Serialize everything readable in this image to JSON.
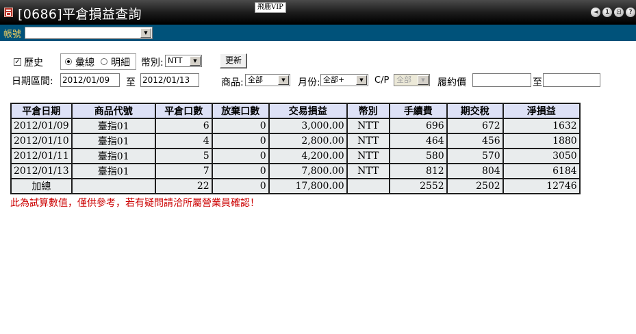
{
  "window": {
    "title": "[0686]平倉損益查詢",
    "vip_badge": "飛鹿VIP",
    "buttons": [
      "◄",
      "1",
      "⊡",
      "?"
    ]
  },
  "account": {
    "label": "帳號",
    "value": ""
  },
  "form": {
    "history_checkbox": {
      "label": "歷史",
      "checked": true
    },
    "summary_radio": {
      "label": "彙總",
      "selected": true
    },
    "detail_radio": {
      "label": "明細",
      "selected": false
    },
    "currency_label": "幣別:",
    "currency_value": "NTT",
    "refresh_button": "更新",
    "date_range_label": "日期區間:",
    "date_from": "2012/01/09",
    "date_to_label": "至",
    "date_to": "2012/01/13",
    "product_label": "商品:",
    "product_value": "全部",
    "month_label": "月份:",
    "month_value": "全部+",
    "cp_label": "C/P",
    "cp_value": "全部",
    "strike_label": "履約價",
    "strike_from": "",
    "strike_to_label": "至",
    "strike_to": ""
  },
  "table": {
    "headers": [
      "平倉日期",
      "商品代號",
      "平倉口數",
      "放棄口數",
      "交易損益",
      "幣別",
      "手續費",
      "期交稅",
      "淨損益"
    ],
    "rows": [
      [
        "2012/01/09",
        "臺指01",
        "6",
        "0",
        "3,000.00",
        "NTT",
        "696",
        "672",
        "1632"
      ],
      [
        "2012/01/10",
        "臺指01",
        "4",
        "0",
        "2,800.00",
        "NTT",
        "464",
        "456",
        "1880"
      ],
      [
        "2012/01/11",
        "臺指01",
        "5",
        "0",
        "4,200.00",
        "NTT",
        "580",
        "570",
        "3050"
      ],
      [
        "2012/01/13",
        "臺指01",
        "7",
        "0",
        "7,800.00",
        "NTT",
        "812",
        "804",
        "6184"
      ]
    ],
    "total": [
      "加總",
      "",
      "22",
      "0",
      "17,800.00",
      "",
      "2552",
      "2502",
      "12746"
    ]
  },
  "notice": "此為試算數值，僅供參考，若有疑問請洽所屬營業員確認！",
  "colors": {
    "account_bar": "#00527a",
    "header_bg": "#dde1f6",
    "cell_bg": "#e9eced",
    "notice": "#cc0000"
  }
}
